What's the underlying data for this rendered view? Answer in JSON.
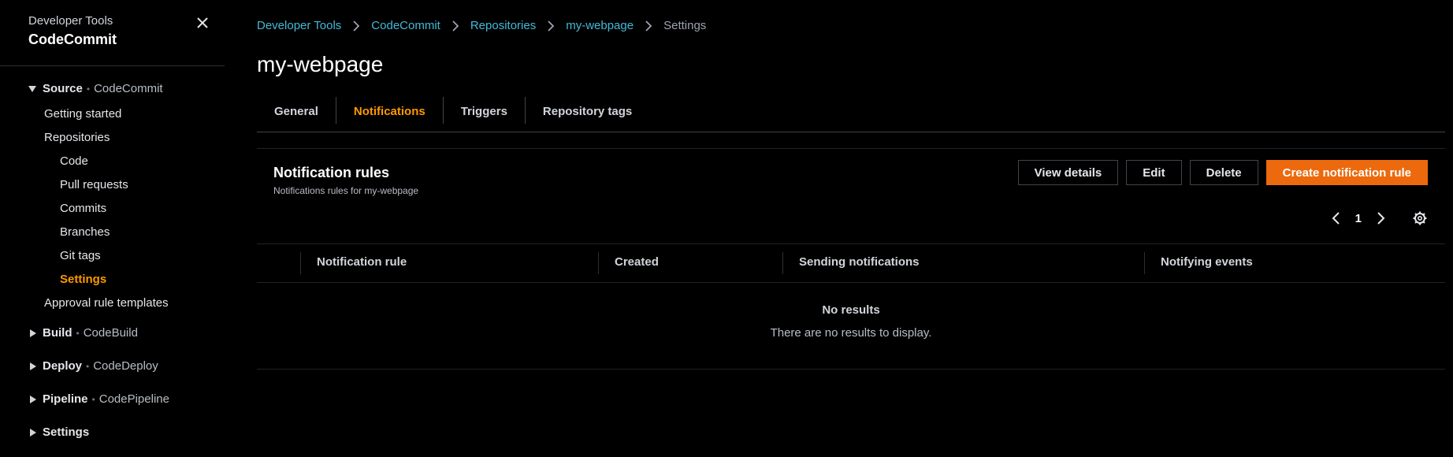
{
  "sidebar": {
    "service": "Developer Tools",
    "title": "CodeCommit",
    "sections": {
      "source": {
        "name": "Source",
        "sub": "CodeCommit"
      },
      "build": {
        "name": "Build",
        "sub": "CodeBuild"
      },
      "deploy": {
        "name": "Deploy",
        "sub": "CodeDeploy"
      },
      "pipeline": {
        "name": "Pipeline",
        "sub": "CodePipeline"
      },
      "settings": {
        "name": "Settings"
      }
    },
    "items": {
      "getting_started": "Getting started",
      "repositories": "Repositories",
      "code": "Code",
      "pull_requests": "Pull requests",
      "commits": "Commits",
      "branches": "Branches",
      "git_tags": "Git tags",
      "settings": "Settings",
      "approval_rule_templates": "Approval rule templates"
    }
  },
  "breadcrumb": [
    "Developer Tools",
    "CodeCommit",
    "Repositories",
    "my-webpage",
    "Settings"
  ],
  "page_title": "my-webpage",
  "tabs": [
    "General",
    "Notifications",
    "Triggers",
    "Repository tags"
  ],
  "panel": {
    "title": "Notification rules",
    "description": "Notifications rules for my-webpage",
    "buttons": {
      "view_details": "View details",
      "edit": "Edit",
      "delete": "Delete",
      "create": "Create notification rule"
    },
    "page_number": "1",
    "columns": [
      "Notification rule",
      "Created",
      "Sending notifications",
      "Notifying events"
    ],
    "empty_title": "No results",
    "empty_desc": "There are no results to display."
  },
  "colors": {
    "accent": "#ff9900",
    "primary_button": "#ec6a0d",
    "link": "#44b9d6"
  }
}
